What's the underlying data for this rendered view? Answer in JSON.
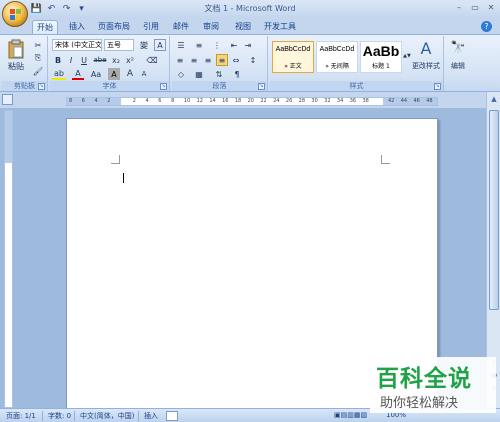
{
  "title": {
    "window_title": "文档 1 - Microsoft Word",
    "qat": [
      "save-icon",
      "undo-icon",
      "redo-icon",
      "customize-icon"
    ],
    "window_controls": [
      "–",
      "▭",
      "✕"
    ]
  },
  "tabs": [
    {
      "label": "开始",
      "active": true
    },
    {
      "label": "插入"
    },
    {
      "label": "页面布局"
    },
    {
      "label": "引用"
    },
    {
      "label": "邮件"
    },
    {
      "label": "审阅"
    },
    {
      "label": "视图"
    },
    {
      "label": "开发工具"
    }
  ],
  "ribbon": {
    "clipboard": {
      "label": "剪贴板",
      "paste": "粘贴"
    },
    "font": {
      "label": "字体",
      "font_name": "宋体 (中文正文)",
      "font_size": "五号",
      "buttons": [
        "B",
        "I",
        "U",
        "abe",
        "x₂",
        "x²",
        "A",
        "Aa",
        "A",
        "A",
        "A"
      ]
    },
    "paragraph": {
      "label": "段落"
    },
    "styles": {
      "label": "样式",
      "items": [
        {
          "sample": "AaBbCcDd",
          "name": "» 正文",
          "selected": true
        },
        {
          "sample": "AaBbCcDd",
          "name": "» 无间隔"
        },
        {
          "sample": "AaBb",
          "name": "标题 1"
        }
      ],
      "change_styles": "更改样式"
    },
    "editing": {
      "label": "编辑"
    }
  },
  "ruler": {
    "ticks": [
      "8",
      "6",
      "4",
      "2",
      "",
      "2",
      "4",
      "6",
      "8",
      "10",
      "12",
      "14",
      "16",
      "18",
      "20",
      "22",
      "24",
      "26",
      "28",
      "30",
      "32",
      "34",
      "36",
      "38",
      "",
      "42",
      "44",
      "46",
      "48"
    ]
  },
  "status": {
    "page": "页面: 1/1",
    "words": "字数: 0",
    "language": "中文(简体，中国)",
    "mode": "插入",
    "zoom": "100%"
  },
  "watermark": {
    "main": "百科全说",
    "sub": "助你轻松解决"
  }
}
